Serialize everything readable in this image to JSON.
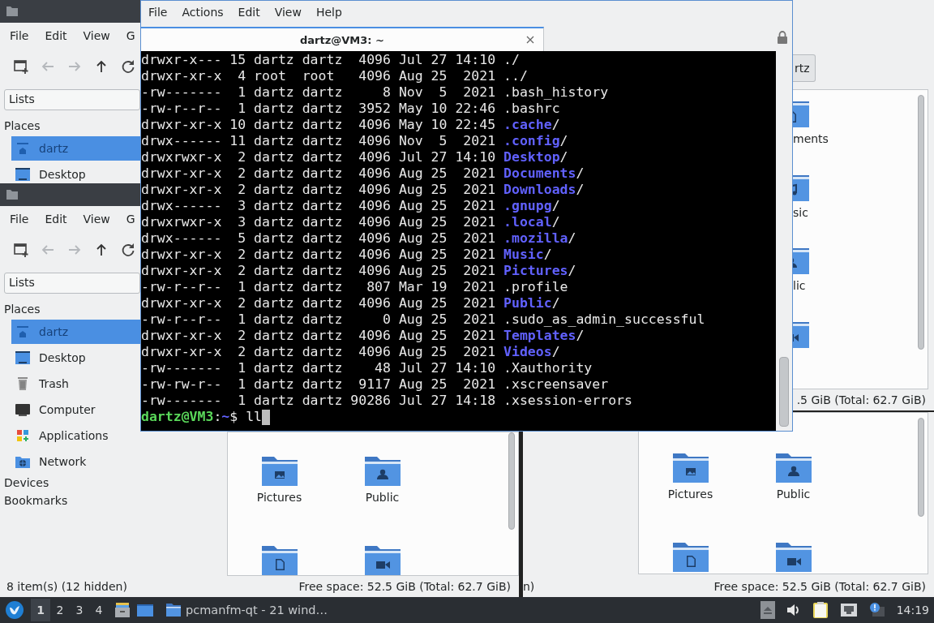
{
  "file_manager_back": {
    "menu": [
      "File",
      "Edit",
      "View",
      "G"
    ],
    "side_pane_selector": "Lists",
    "places_heading": "Places",
    "places": [
      {
        "label": "dartz",
        "kind": "home",
        "selected": true
      },
      {
        "label": "Desktop",
        "kind": "desktop",
        "selected": false
      }
    ]
  },
  "file_manager_front": {
    "menu": [
      "File",
      "Edit",
      "View",
      "G"
    ],
    "side_pane_selector": "Lists",
    "places_heading": "Places",
    "places": [
      {
        "label": "dartz",
        "kind": "home",
        "selected": true
      },
      {
        "label": "Desktop",
        "kind": "desktop",
        "selected": false
      },
      {
        "label": "Trash",
        "kind": "trash",
        "selected": false
      },
      {
        "label": "Computer",
        "kind": "computer",
        "selected": false
      },
      {
        "label": "Applications",
        "kind": "applications",
        "selected": false
      },
      {
        "label": "Network",
        "kind": "network",
        "selected": false
      }
    ],
    "sections": [
      "Devices",
      "Bookmarks"
    ],
    "files": [
      {
        "label": "Pictures",
        "kind": "pictures"
      },
      {
        "label": "Public",
        "kind": "public"
      },
      {
        "kind": "documents"
      },
      {
        "kind": "videos"
      }
    ],
    "status_left": "8 item(s) (12 hidden)",
    "status_right": "Free space: 52.5 GiB (Total: 62.7 GiB)"
  },
  "file_manager_right_top": {
    "path_button": "rtz",
    "files": [
      {
        "label": "ments",
        "kind": "documents"
      },
      {
        "label": "sic",
        "kind": "music"
      },
      {
        "label": "lic",
        "kind": "public"
      },
      {
        "kind": "videos"
      }
    ],
    "status_right": ".5 GiB (Total: 62.7 GiB)"
  },
  "file_manager_right_bottom": {
    "files": [
      {
        "label": "Pictures",
        "kind": "pictures"
      },
      {
        "label": "Public",
        "kind": "public"
      },
      {
        "kind": "documents"
      },
      {
        "kind": "videos"
      }
    ],
    "status_left": "n)",
    "status_right": "Free space: 52.5 GiB (Total: 62.7 GiB)"
  },
  "terminal": {
    "menu": [
      "File",
      "Actions",
      "Edit",
      "View",
      "Help"
    ],
    "tab_title": "dartz@VM3: ~",
    "lines": [
      {
        "text": "drwxr-x--- 15 dartz dartz  4096 Jul 27 14:10 ",
        "name": "./",
        "dir": false
      },
      {
        "text": "drwxr-xr-x  4 root  root   4096 Aug 25  2021 ",
        "name": "../",
        "dir": false
      },
      {
        "text": "-rw-------  1 dartz dartz     8 Nov  5  2021 ",
        "name": ".bash_history",
        "dir": false
      },
      {
        "text": "-rw-r--r--  1 dartz dartz  3952 May 10 22:46 ",
        "name": ".bashrc",
        "dir": false
      },
      {
        "text": "drwxr-xr-x 10 dartz dartz  4096 May 10 22:45 ",
        "name": ".cache",
        "dir": true,
        "suffix": "/"
      },
      {
        "text": "drwx------ 11 dartz dartz  4096 Nov  5  2021 ",
        "name": ".config",
        "dir": true,
        "suffix": "/"
      },
      {
        "text": "drwxrwxr-x  2 dartz dartz  4096 Jul 27 14:10 ",
        "name": "Desktop",
        "dir": true,
        "suffix": "/"
      },
      {
        "text": "drwxr-xr-x  2 dartz dartz  4096 Aug 25  2021 ",
        "name": "Documents",
        "dir": true,
        "suffix": "/"
      },
      {
        "text": "drwxr-xr-x  2 dartz dartz  4096 Aug 25  2021 ",
        "name": "Downloads",
        "dir": true,
        "suffix": "/"
      },
      {
        "text": "drwx------  3 dartz dartz  4096 Aug 25  2021 ",
        "name": ".gnupg",
        "dir": true,
        "suffix": "/"
      },
      {
        "text": "drwxrwxr-x  3 dartz dartz  4096 Aug 25  2021 ",
        "name": ".local",
        "dir": true,
        "suffix": "/"
      },
      {
        "text": "drwx------  5 dartz dartz  4096 Aug 25  2021 ",
        "name": ".mozilla",
        "dir": true,
        "suffix": "/"
      },
      {
        "text": "drwxr-xr-x  2 dartz dartz  4096 Aug 25  2021 ",
        "name": "Music",
        "dir": true,
        "suffix": "/"
      },
      {
        "text": "drwxr-xr-x  2 dartz dartz  4096 Aug 25  2021 ",
        "name": "Pictures",
        "dir": true,
        "suffix": "/"
      },
      {
        "text": "-rw-r--r--  1 dartz dartz   807 Mar 19  2021 ",
        "name": ".profile",
        "dir": false
      },
      {
        "text": "drwxr-xr-x  2 dartz dartz  4096 Aug 25  2021 ",
        "name": "Public",
        "dir": true,
        "suffix": "/"
      },
      {
        "text": "-rw-r--r--  1 dartz dartz     0 Aug 25  2021 ",
        "name": ".sudo_as_admin_successful",
        "dir": false
      },
      {
        "text": "drwxr-xr-x  2 dartz dartz  4096 Aug 25  2021 ",
        "name": "Templates",
        "dir": true,
        "suffix": "/"
      },
      {
        "text": "drwxr-xr-x  2 dartz dartz  4096 Aug 25  2021 ",
        "name": "Videos",
        "dir": true,
        "suffix": "/"
      },
      {
        "text": "-rw-------  1 dartz dartz    48 Jul 27 14:10 ",
        "name": ".Xauthority",
        "dir": false
      },
      {
        "text": "-rw-rw-r--  1 dartz dartz  9117 Aug 25  2021 ",
        "name": ".xscreensaver",
        "dir": false
      },
      {
        "text": "-rw-------  1 dartz dartz 90286 Jul 27 14:18 ",
        "name": ".xsession-errors",
        "dir": false
      }
    ],
    "prompt": {
      "user_host": "dartz@VM3",
      "separator": ":",
      "path": "~",
      "symbol": "$",
      "command": "ll"
    }
  },
  "taskbar": {
    "workspaces": [
      {
        "label": "1",
        "selected": true
      },
      {
        "label": "2",
        "selected": false
      },
      {
        "label": "3",
        "selected": false
      },
      {
        "label": "4",
        "selected": false
      }
    ],
    "task": "pcmanfm-qt - 21 wind…",
    "clock": "14:19"
  }
}
